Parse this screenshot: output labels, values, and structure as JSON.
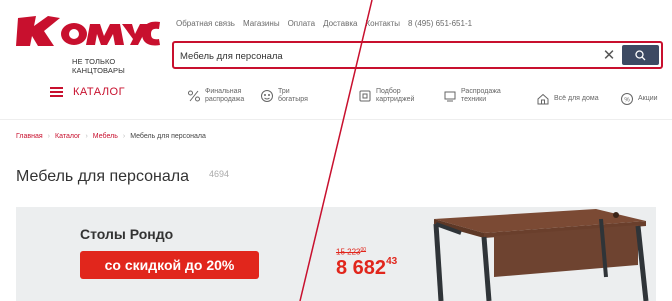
{
  "brand": {
    "name": "Комус",
    "tagline": "НЕ ТОЛЬКО КАНЦТОВАРЫ",
    "color": "#c8102e"
  },
  "top_links": [
    "Обратная связь",
    "Магазины",
    "Оплата",
    "Доставка",
    "Контакты",
    "8 (495) 651-651-1"
  ],
  "search": {
    "value": "Мебель для персонала",
    "button_color": "#3d4a63"
  },
  "nav": {
    "catalog_label": "КАТАЛОГ",
    "items": [
      {
        "icon": "percent-icon",
        "lines": [
          "Финальная",
          "распродажа"
        ]
      },
      {
        "icon": "heroes-icon",
        "lines": [
          "Три",
          "богатыря"
        ]
      },
      {
        "icon": "cartridge-icon",
        "lines": [
          "Подбор",
          "картриджей"
        ]
      },
      {
        "icon": "tech-icon",
        "lines": [
          "Распродажа",
          "техники"
        ]
      },
      {
        "icon": "home-icon",
        "lines": [
          "Всё для дома"
        ]
      },
      {
        "icon": "sale-icon",
        "lines": [
          "Акции"
        ]
      }
    ]
  },
  "breadcrumbs": [
    "Главная",
    "Каталог",
    "Мебель",
    "Мебель для персонала"
  ],
  "page": {
    "title": "Мебель для персонала",
    "count": "4694"
  },
  "promo": {
    "title": "Столы Рондо",
    "badge": "со скидкой до 20%",
    "old_price": "15 223",
    "old_price_kop": "00",
    "new_price": "8 682",
    "new_price_kop": "43",
    "accent_color": "#e1261c"
  }
}
